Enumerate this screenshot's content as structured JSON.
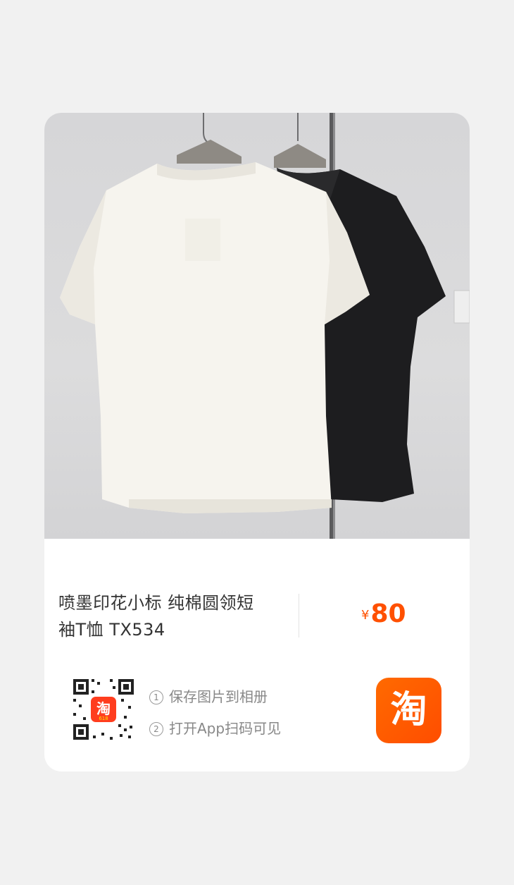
{
  "product": {
    "title_line1": "喷墨印花小标 纯棉圆领短",
    "title_line2": "袖T恤 TX534",
    "currency": "¥",
    "price": "80"
  },
  "steps": [
    {
      "num": "1",
      "label": "保存图片到相册"
    },
    {
      "num": "2",
      "label": "打开App扫码可见"
    }
  ],
  "qr": {
    "center_logo_text": "淘",
    "center_logo_badge": "618"
  },
  "app_logo": {
    "text": "淘",
    "color": "#ff5000"
  },
  "colors": {
    "price": "#ff5000",
    "background": "#f1f1f1",
    "card": "#ffffff"
  },
  "icons": {
    "product_image": "product-photo-white-and-black-tshirts",
    "qr_code": "qr-code-icon",
    "taobao_logo": "taobao-logo-icon"
  }
}
